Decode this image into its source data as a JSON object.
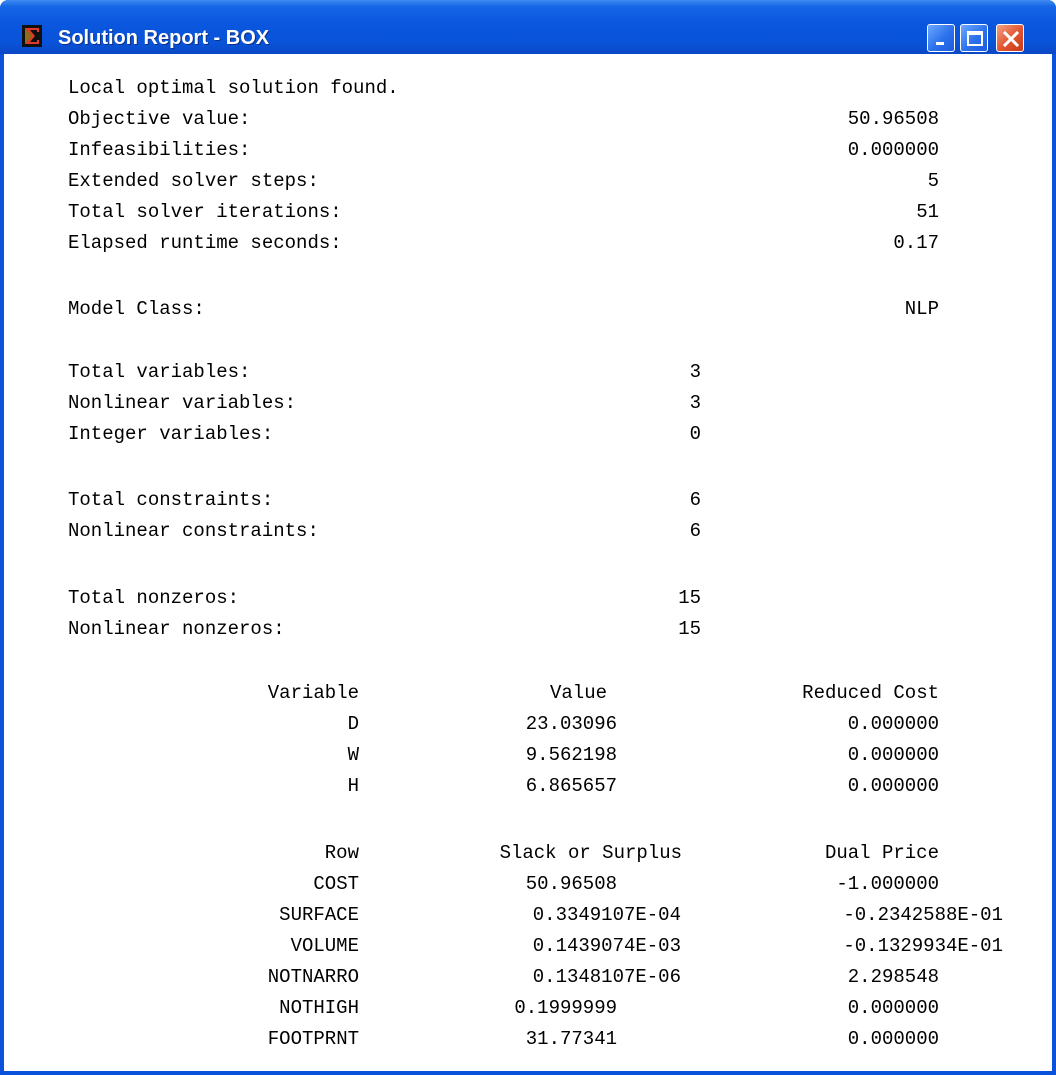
{
  "window": {
    "title": "Solution Report - BOX",
    "icon": "lingo-sigma-icon",
    "controls": [
      "minimize",
      "maximize",
      "close"
    ]
  },
  "summary": {
    "status": "Local optimal solution found.",
    "objective": {
      "label": "Objective value:",
      "value": "50.96508"
    },
    "infeasibilities": {
      "label": "Infeasibilities:",
      "value": "0.000000"
    },
    "extended_steps": {
      "label": "Extended solver steps:",
      "value": "5"
    },
    "iterations": {
      "label": "Total solver iterations:",
      "value": "51"
    },
    "runtime": {
      "label": "Elapsed runtime seconds:",
      "value": "0.17"
    },
    "model_class": {
      "label": "Model Class:",
      "value": "NLP"
    }
  },
  "stats": {
    "total_variables": {
      "label": "Total variables:",
      "value": "3"
    },
    "nonlinear_variables": {
      "label": "Nonlinear variables:",
      "value": "3"
    },
    "integer_variables": {
      "label": "Integer variables:",
      "value": "0"
    },
    "total_constraints": {
      "label": "Total constraints:",
      "value": "6"
    },
    "nonlinear_constraints": {
      "label": "Nonlinear constraints:",
      "value": "6"
    },
    "total_nonzeros": {
      "label": "Total nonzeros:",
      "value": "15"
    },
    "nonlinear_nonzeros": {
      "label": "Nonlinear nonzeros:",
      "value": "15"
    }
  },
  "variables": {
    "headers": [
      "Variable",
      "Value",
      "Reduced Cost"
    ],
    "rows": [
      [
        "D",
        "23.03096",
        "0.000000"
      ],
      [
        "W",
        "9.562198",
        "0.000000"
      ],
      [
        "H",
        "6.865657",
        "0.000000"
      ]
    ]
  },
  "rows_table": {
    "headers": [
      "Row",
      "Slack or Surplus",
      "Dual Price"
    ],
    "rows": [
      [
        "COST",
        "50.96508",
        "-1.000000"
      ],
      [
        "SURFACE",
        "0.3349107E-04",
        "-0.2342588E-01"
      ],
      [
        "VOLUME",
        "0.1439074E-03",
        "-0.1329934E-01"
      ],
      [
        "NOTNARRO",
        "0.1348107E-06",
        "2.298548"
      ],
      [
        "NOTHIGH",
        "0.1999999",
        "0.000000"
      ],
      [
        "FOOTPRNT",
        "31.77341",
        "0.000000"
      ]
    ]
  },
  "colors": {
    "titlebar": "#0a56de",
    "close_button": "#e2532e",
    "text": "#000000",
    "background": "#ffffff"
  }
}
